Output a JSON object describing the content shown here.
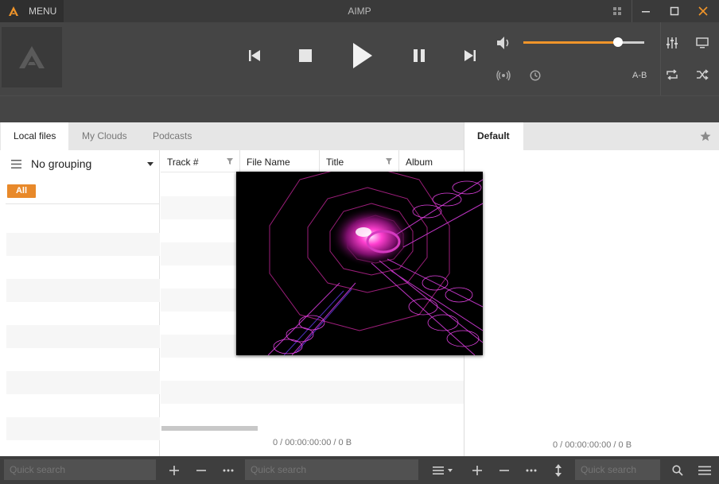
{
  "window": {
    "title": "AIMP",
    "menu_label": "MENU"
  },
  "player": {
    "volume_level": 0.78,
    "ab_label": "A-B",
    "accent_color": "#f0952a"
  },
  "left_tabs": [
    {
      "label": "Local files",
      "active": true
    },
    {
      "label": "My Clouds",
      "active": false
    },
    {
      "label": "Podcasts",
      "active": false
    }
  ],
  "grouping": {
    "label": "No grouping",
    "all_badge": "All"
  },
  "columns": [
    {
      "label": "Track #",
      "filter": true
    },
    {
      "label": "File Name",
      "filter": false
    },
    {
      "label": "Title",
      "filter": true
    },
    {
      "label": "Album",
      "filter": false
    }
  ],
  "library_status": "0 / 00:00:00:00 / 0 B",
  "playlist": {
    "tab_label": "Default",
    "status": "0 / 00:00:00:00 / 0 B"
  },
  "bottom_bar": {
    "groups_search_placeholder": "Quick search",
    "library_search_placeholder": "Quick search",
    "playlist_search_placeholder": "Quick search"
  },
  "icons": [
    "aimp-logo-icon",
    "grid-icon",
    "minimize-icon",
    "maximize-icon",
    "close-icon",
    "previous-icon",
    "stop-icon",
    "play-icon",
    "pause-icon",
    "next-icon",
    "speaker-icon",
    "equalizer-icon",
    "monitor-icon",
    "radio-icon",
    "clock-icon",
    "repeat-icon",
    "shuffle-icon",
    "hamburger-icon",
    "caret-down-icon",
    "filter-icon",
    "star-icon",
    "plus-icon",
    "minus-icon",
    "more-icon",
    "sort-icon",
    "updown-icon",
    "search-icon",
    "menu-icon"
  ]
}
